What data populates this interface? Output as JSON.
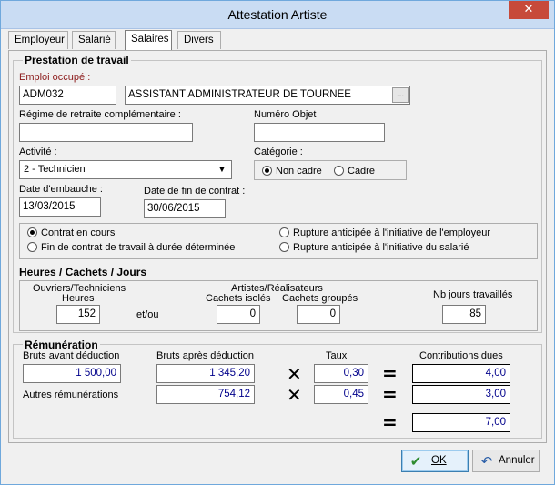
{
  "window": {
    "title": "Attestation Artiste",
    "close_glyph": "✕"
  },
  "tabs": [
    {
      "label": "Employeur"
    },
    {
      "label": "Salarié"
    },
    {
      "label": "Salaires",
      "active": true
    },
    {
      "label": "Divers"
    }
  ],
  "prestation": {
    "title": "Prestation de travail",
    "emploi_label": "Emploi occupé :",
    "emploi_code": "ADM032",
    "emploi_libelle": "ASSISTANT ADMINISTRATEUR DE TOURNEE",
    "ellipsis": "...",
    "regime_label": "Régime de retraite complémentaire :",
    "regime_value": "",
    "numero_objet_label": "Numéro  Objet",
    "numero_objet_value": "",
    "activite_label": "Activité :",
    "activite_value": "2 - Technicien",
    "categorie_label": "Catégorie :",
    "categorie_options": [
      {
        "label": "Non cadre",
        "selected": true
      },
      {
        "label": "Cadre",
        "selected": false
      }
    ],
    "date_embauche_label": "Date d'embauche :",
    "date_embauche_value": "13/03/2015",
    "date_fin_label": "Date de fin de contrat :",
    "date_fin_value": "30/06/2015",
    "contrat_options": [
      {
        "label": "Contrat en cours",
        "selected": true
      },
      {
        "label": "Fin de contrat de travail à durée déterminée",
        "selected": false
      },
      {
        "label": "Rupture anticipée à l'initiative de l'employeur",
        "selected": false
      },
      {
        "label": "Rupture anticipée à l'initiative du salarié",
        "selected": false
      }
    ]
  },
  "heures": {
    "title": "Heures / Cachets / Jours",
    "ouvriers_label": "Ouvriers/Techniciens",
    "heures_label": "Heures",
    "heures_value": "152",
    "etou": "et/ou",
    "artistes_label": "Artistes/Réalisateurs",
    "cachets_isoles_label": "Cachets isolés",
    "cachets_isoles_value": "0",
    "cachets_groupes_label": "Cachets groupés",
    "cachets_groupes_value": "0",
    "nb_jours_label": "Nb jours travaillés",
    "nb_jours_value": "85"
  },
  "remuneration": {
    "title": "Rémunération",
    "bruts_avant_label": "Bruts avant déduction",
    "bruts_avant_value": "1 500,00",
    "bruts_apres_label": "Bruts après déduction",
    "bruts_apres_value": "1 345,20",
    "taux_label": "Taux",
    "taux1_value": "0,30",
    "contributions_label": "Contributions dues",
    "contrib1_value": "4,00",
    "autres_label": "Autres rémunérations",
    "autres_value": "754,12",
    "taux2_value": "0,45",
    "contrib2_value": "3,00",
    "total_value": "7,00",
    "times_glyph": "✕",
    "equals_glyph": "="
  },
  "buttons": {
    "ok_label": "OK",
    "ok_icon_glyph": "✔",
    "annuler_label": "Annuler",
    "annuler_icon_glyph": "↶"
  },
  "colors": {
    "value_blue": "#00008b",
    "emploi_label_red": "#8b1a1a"
  }
}
